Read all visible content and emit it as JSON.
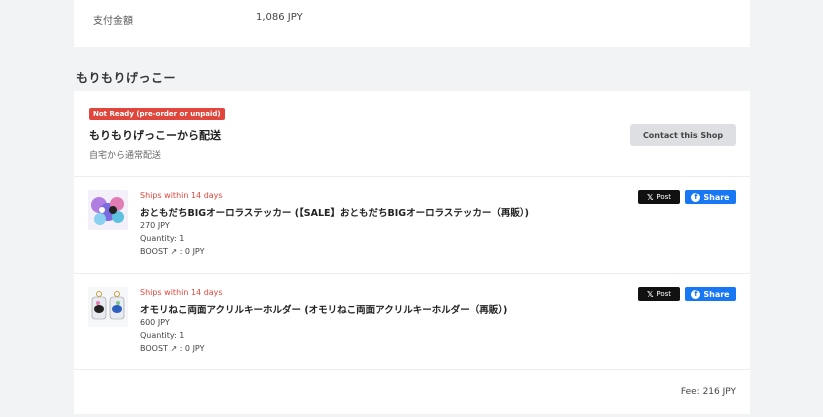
{
  "payment": {
    "label": "支付金額",
    "value": "1,086 JPY"
  },
  "shop": {
    "name": "もりもりげっこー",
    "badge": "Not Ready (pre-order or unpaid)",
    "ship_from": "もりもりげっこーから配送",
    "ship_method": "自宅から通常配送",
    "contact_label": "Contact this Shop"
  },
  "items": [
    {
      "ships": "Ships within 14 days",
      "title": "おともだちBIGオーロラステッカー (【SALE】おともだちBIGオーロラステッカー（再販）)",
      "price": "270 JPY",
      "quantity": "Quantity: 1",
      "boost": "BOOST ↗ : 0 JPY",
      "x_label": "Post",
      "fb_label": "Share"
    },
    {
      "ships": "Ships within 14 days",
      "title": "オモリねこ両面アクリルキーホルダー (オモリねこ両面アクリルキーホルダー（再販）)",
      "price": "600 JPY",
      "quantity": "Quantity: 1",
      "boost": "BOOST ↗ : 0 JPY",
      "x_label": "Post",
      "fb_label": "Share"
    }
  ],
  "fee": "Fee: 216 JPY",
  "colors": {
    "badge": "#e0463b",
    "facebook": "#1877f2",
    "x": "#111111"
  }
}
